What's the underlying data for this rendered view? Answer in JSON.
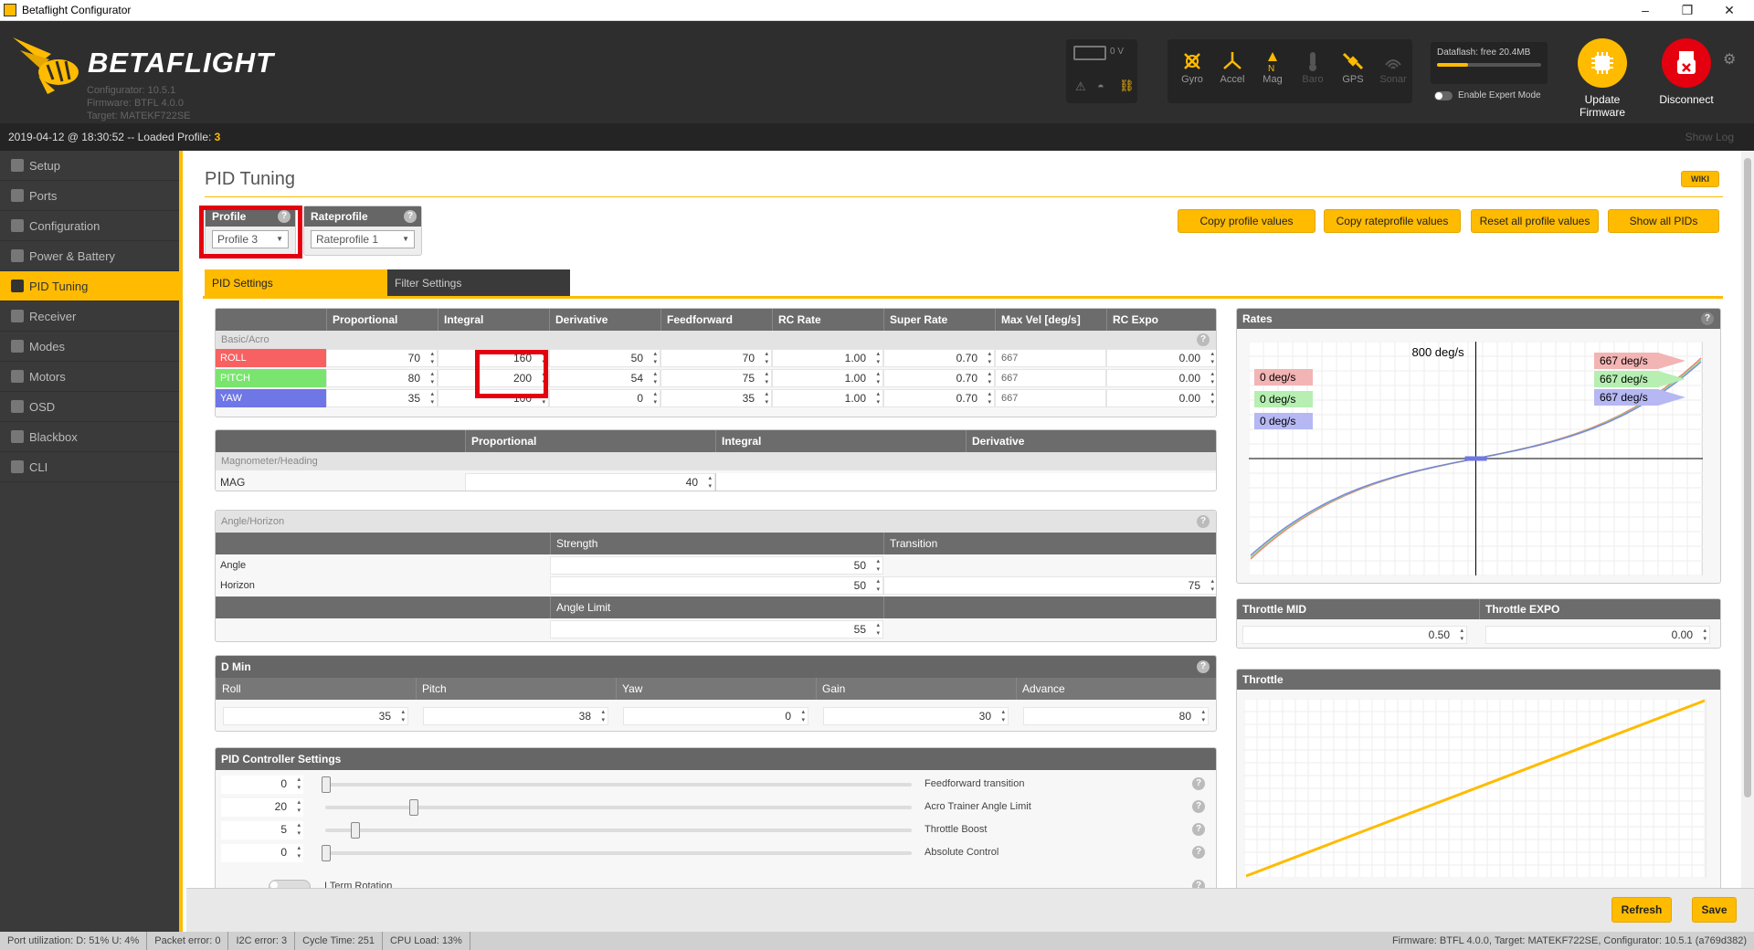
{
  "window": {
    "title": "Betaflight Configurator",
    "min": "–",
    "max": "❐",
    "close": "✕"
  },
  "logo": {
    "brand": "BETAFLIGHT",
    "configurator": "Configurator: 10.5.1",
    "firmware": "Firmware: BTFL 4.0.0",
    "target": "Target: MATEKF722SE"
  },
  "battery": {
    "voltage": "0 V"
  },
  "sensors": [
    {
      "label": "Gyro",
      "icon": "gyro-icon",
      "active": true
    },
    {
      "label": "Accel",
      "icon": "accel-icon",
      "active": true
    },
    {
      "label": "Mag",
      "icon": "mag-icon",
      "active": true
    },
    {
      "label": "Baro",
      "icon": "baro-icon",
      "active": false
    },
    {
      "label": "GPS",
      "icon": "gps-icon",
      "active": true
    },
    {
      "label": "Sonar",
      "icon": "sonar-icon",
      "active": false
    }
  ],
  "dataflash": {
    "label": "Dataflash: free 20.4MB",
    "used_fraction": 0.3
  },
  "expert_mode": {
    "label": "Enable Expert Mode"
  },
  "update_firmware": {
    "label": "Update Firmware"
  },
  "disconnect": {
    "label": "Disconnect"
  },
  "logbar": {
    "text": "2019-04-12 @ 18:30:52 -- Loaded Profile: ",
    "profile": "3",
    "show_log": "Show Log"
  },
  "nav": [
    {
      "label": "Setup"
    },
    {
      "label": "Ports"
    },
    {
      "label": "Configuration"
    },
    {
      "label": "Power & Battery"
    },
    {
      "label": "PID Tuning",
      "active": true
    },
    {
      "label": "Receiver"
    },
    {
      "label": "Modes"
    },
    {
      "label": "Motors"
    },
    {
      "label": "OSD"
    },
    {
      "label": "Blackbox"
    },
    {
      "label": "CLI"
    }
  ],
  "page": {
    "title": "PID Tuning",
    "wiki": "WIKI"
  },
  "profile": {
    "label": "Profile",
    "value": "Profile 3"
  },
  "rateprofile": {
    "label": "Rateprofile",
    "value": "Rateprofile 1"
  },
  "buttons": {
    "copy_profile": "Copy profile values",
    "copy_rateprofile": "Copy rateprofile values",
    "reset_profile": "Reset all profile values",
    "show_all": "Show all PIDs",
    "refresh": "Refresh",
    "save": "Save"
  },
  "tabs": {
    "pid": "PID Settings",
    "filter": "Filter Settings"
  },
  "pid_table": {
    "columns": [
      "Proportional",
      "Integral",
      "Derivative",
      "Feedforward",
      "RC Rate",
      "Super Rate",
      "Max Vel [deg/s]",
      "RC Expo"
    ],
    "section": "Basic/Acro",
    "rows": [
      {
        "name": "ROLL",
        "color": "#f86161",
        "p": "70",
        "i": "160",
        "d": "50",
        "ff": "70",
        "rc_rate": "1.00",
        "super_rate": "0.70",
        "max_vel": "667",
        "expo": "0.00"
      },
      {
        "name": "PITCH",
        "color": "#79e56f",
        "p": "80",
        "i": "200",
        "d": "54",
        "ff": "75",
        "rc_rate": "1.00",
        "super_rate": "0.70",
        "max_vel": "667",
        "expo": "0.00"
      },
      {
        "name": "YAW",
        "color": "#6f76e5",
        "p": "35",
        "i": "100",
        "d": "0",
        "ff": "35",
        "rc_rate": "1.00",
        "super_rate": "0.70",
        "max_vel": "667",
        "expo": "0.00"
      }
    ]
  },
  "mag": {
    "cols": [
      "Proportional",
      "Integral",
      "Derivative"
    ],
    "section": "Magnometer/Heading",
    "label": "MAG",
    "p": "40"
  },
  "angle": {
    "section": "Angle/Horizon",
    "strength": "Strength",
    "transition": "Transition",
    "angle_label": "Angle",
    "angle_strength": "50",
    "horizon_label": "Horizon",
    "horizon_strength": "50",
    "horizon_transition": "75",
    "limit_label": "Angle Limit",
    "limit": "55"
  },
  "dmin": {
    "title": "D Min",
    "cols": [
      "Roll",
      "Pitch",
      "Yaw",
      "Gain",
      "Advance"
    ],
    "values": [
      "35",
      "38",
      "0",
      "30",
      "80"
    ]
  },
  "pidctrl": {
    "title": "PID Controller Settings",
    "rows": [
      {
        "value": "0",
        "label": "Feedforward transition",
        "level": 0.0
      },
      {
        "value": "20",
        "label": "Acro Trainer Angle Limit",
        "level": 0.15
      },
      {
        "value": "5",
        "label": "Throttle Boost",
        "level": 0.05
      },
      {
        "value": "0",
        "label": "Absolute Control",
        "level": 0.0
      }
    ],
    "iterm": "I Term Rotation"
  },
  "rates": {
    "title": "Rates",
    "max_label": "800 deg/s",
    "live": [
      {
        "text": "0 deg/s",
        "color": "#f3b4b4"
      },
      {
        "text": "0 deg/s",
        "color": "#b6efb1"
      },
      {
        "text": "0 deg/s",
        "color": "#b5b8f2"
      }
    ],
    "max": [
      {
        "text": "667 deg/s",
        "color": "#f3b4b4"
      },
      {
        "text": "667 deg/s",
        "color": "#b6efb1"
      },
      {
        "text": "667 deg/s",
        "color": "#b5b8f2"
      }
    ]
  },
  "throttle": {
    "mid_label": "Throttle MID",
    "mid": "0.50",
    "expo_label": "Throttle EXPO",
    "expo": "0.00",
    "title": "Throttle"
  },
  "footer": {
    "port": "Port utilization: D: 51% U: 4%",
    "packet": "Packet error: 0",
    "i2c": "I2C error: 3",
    "cycle": "Cycle Time: 251",
    "cpu": "CPU Load: 13%",
    "fw": "Firmware: BTFL 4.0.0, Target: MATEKF722SE, Configurator: 10.5.1 (a769d382)"
  },
  "colors": {
    "accent": "#ffbb00",
    "highlight": "#e4000f"
  }
}
